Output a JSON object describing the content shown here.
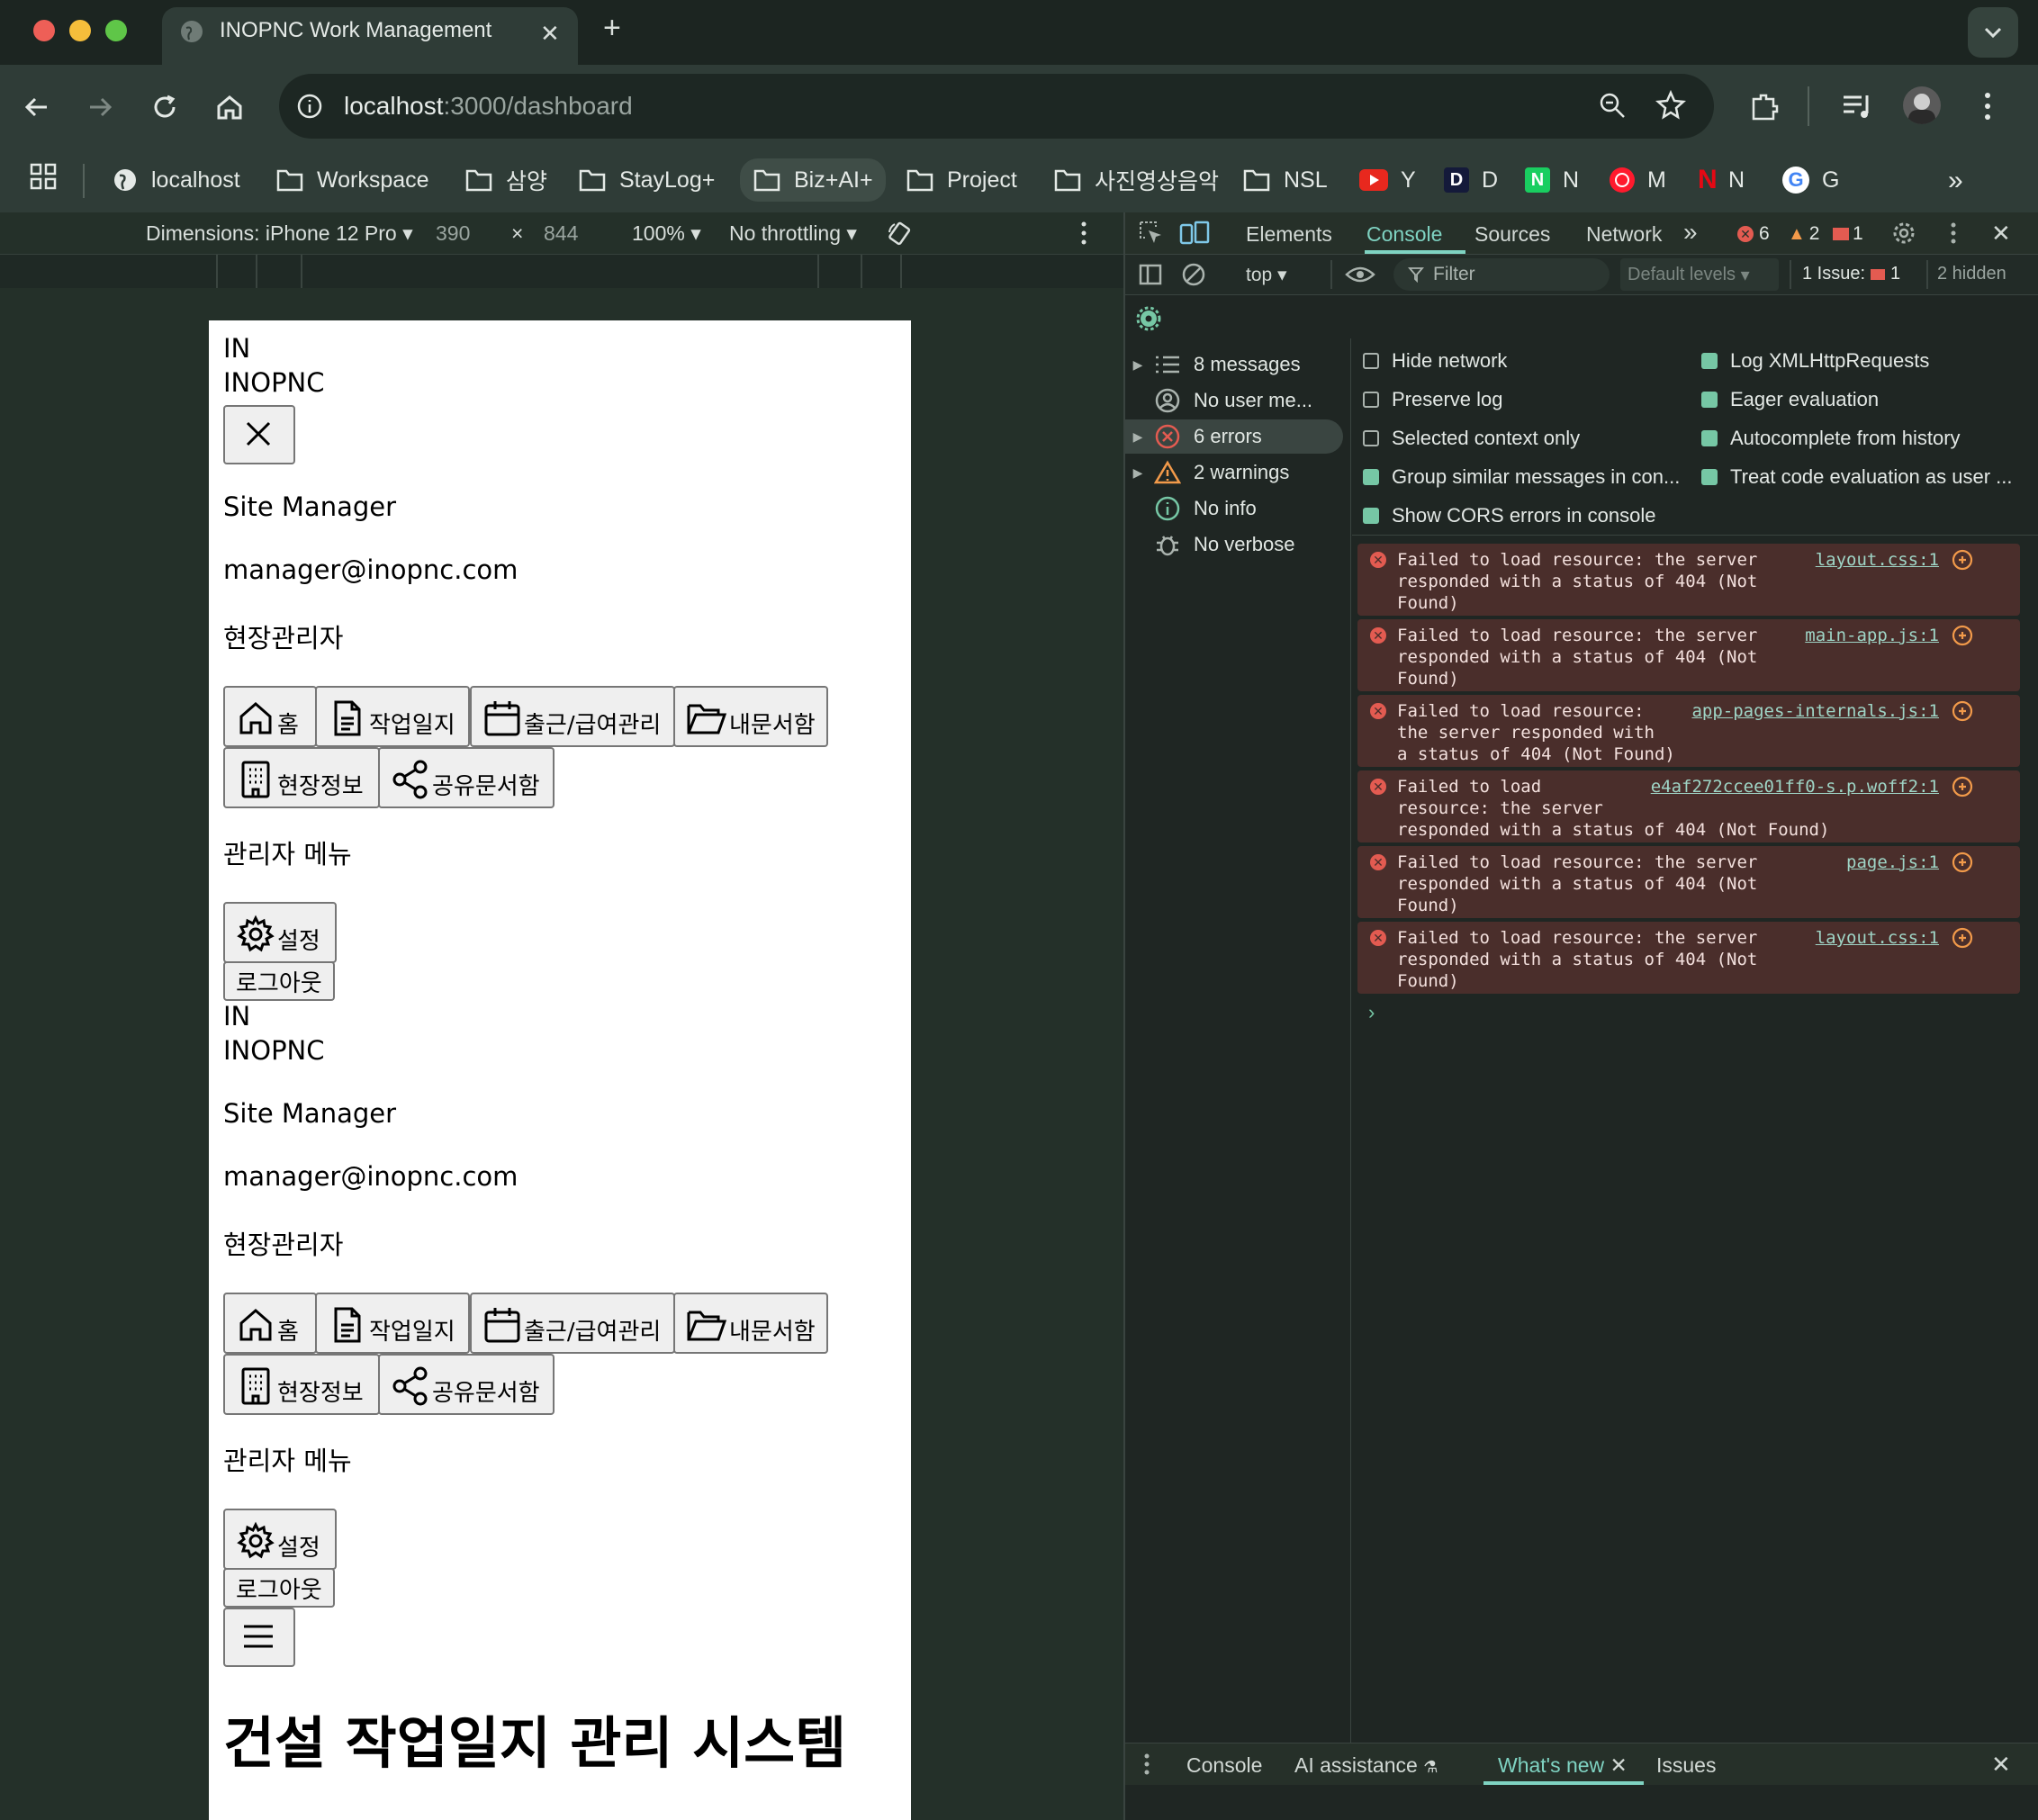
{
  "browser": {
    "tab_title": "INOPNC Work Management",
    "url_host": "localhost",
    "url_path": ":3000/dashboard",
    "bookmarks": [
      "localhost",
      "Workspace",
      "삼양",
      "StayLog+",
      "Biz+AI+",
      "Project",
      "사진영상음악",
      "NSL",
      "Y",
      "D",
      "N",
      "M",
      "N",
      "G"
    ]
  },
  "device_toolbar": {
    "dimensions_label": "Dimensions: iPhone 12 Pro",
    "width": "390",
    "times": "×",
    "height": "844",
    "zoom": "100%",
    "throttling": "No throttling"
  },
  "page": {
    "logo_short": "IN",
    "logo_full": "INOPNC",
    "user_name": "Site Manager",
    "user_email": "manager@inopnc.com",
    "user_role": "현장관리자",
    "nav": {
      "home": "홈",
      "daily_report": "작업일지",
      "attendance": "출근/급여관리",
      "my_docs": "내문서함",
      "site_info": "현장정보",
      "shared_docs": "공유문서함"
    },
    "admin_menu": "관리자 메뉴",
    "settings": "설정",
    "logout": "로그아웃",
    "heading": "건설 작업일지 관리 시스템"
  },
  "devtools": {
    "tabs": {
      "elements": "Elements",
      "console": "Console",
      "sources": "Sources",
      "network": "Network"
    },
    "counts": {
      "errors": "6",
      "warnings": "2",
      "issues": "1"
    },
    "context": "top",
    "filter_placeholder": "Filter",
    "levels": "Default levels",
    "issues_label": "1 Issue:",
    "issues_count": "1",
    "hidden": "2 hidden",
    "sidebar": {
      "messages": "8 messages",
      "user": "No user me...",
      "errors": "6 errors",
      "warnings": "2 warnings",
      "info": "No info",
      "verbose": "No verbose"
    },
    "options": {
      "hide_network": "Hide network",
      "preserve_log": "Preserve log",
      "selected_context": "Selected context only",
      "group_similar": "Group similar messages in con...",
      "show_cors": "Show CORS errors in console",
      "log_xhr": "Log XMLHttpRequests",
      "eager_eval": "Eager evaluation",
      "autocomplete": "Autocomplete from history",
      "treat_code": "Treat code evaluation as user ..."
    },
    "errors": [
      {
        "msg": "Failed to load resource: the server\nresponded with a status of 404 (Not\nFound)",
        "src": "layout.css:1"
      },
      {
        "msg": "Failed to load resource: the server\nresponded with a status of 404 (Not\nFound)",
        "src": "main-app.js:1"
      },
      {
        "msg": "Failed to load resource:\nthe server responded with\na status of 404 (Not Found)",
        "src": "app-pages-internals.js:1"
      },
      {
        "msg": "Failed to load\nresource: the server\nresponded with a status of 404 (Not Found)",
        "src": "e4af272ccee01ff0-s.p.woff2:1"
      },
      {
        "msg": "Failed to load resource: the server\nresponded with a status of 404 (Not\nFound)",
        "src": "page.js:1"
      },
      {
        "msg": "Failed to load resource: the server\nresponded with a status of 404 (Not\nFound)",
        "src": "layout.css:1"
      }
    ],
    "drawer": {
      "console": "Console",
      "ai": "AI assistance",
      "whats_new": "What's new",
      "issues": "Issues"
    }
  }
}
